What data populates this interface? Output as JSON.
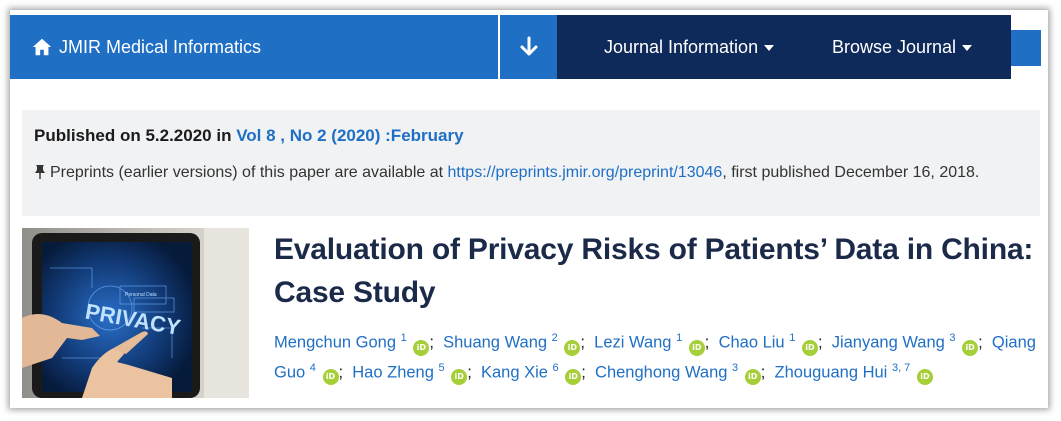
{
  "nav": {
    "brand": "JMIR Medical Informatics",
    "menu": [
      {
        "label": "Journal Information"
      },
      {
        "label": "Browse Journal"
      }
    ]
  },
  "pub": {
    "published_prefix": "Published on 5.2.2020 in ",
    "issue_link": "Vol 8 , No 2 (2020) :February",
    "preprint_text": "Preprints (earlier versions) of this paper are available at ",
    "preprint_url": "https://preprints.jmir.org/preprint/13046",
    "preprint_suffix": ", first published December 16, 2018."
  },
  "image": {
    "label": "PRIVACY",
    "small": "Personal Data"
  },
  "article": {
    "title": "Evaluation of Privacy Risks of Patients’ Data in China: Case Study"
  },
  "authors": [
    {
      "name": "Mengchun Gong",
      "aff": "1"
    },
    {
      "name": "Shuang Wang",
      "aff": "2"
    },
    {
      "name": "Lezi Wang",
      "aff": "1"
    },
    {
      "name": "Chao Liu",
      "aff": "1"
    },
    {
      "name": "Jianyang Wang",
      "aff": "3"
    },
    {
      "name": "Qiang Guo",
      "aff": "4"
    },
    {
      "name": "Hao Zheng",
      "aff": "5"
    },
    {
      "name": "Kang Xie",
      "aff": "6"
    },
    {
      "name": "Chenghong Wang",
      "aff": "3"
    },
    {
      "name": "Zhouguang Hui",
      "aff": "3, 7"
    }
  ],
  "orcid_label": "iD",
  "colors": {
    "brand_blue": "#1f6fc5",
    "nav_dark": "#0e2a5a",
    "orcid_green": "#a6ce39",
    "title": "#1c2a4a"
  }
}
